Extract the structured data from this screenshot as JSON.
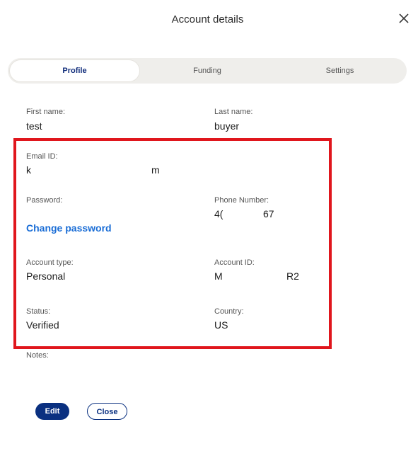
{
  "dialog": {
    "title": "Account details"
  },
  "tabs": [
    {
      "label": "Profile",
      "active": true
    },
    {
      "label": "Funding",
      "active": false
    },
    {
      "label": "Settings",
      "active": false
    }
  ],
  "profile": {
    "first_name": {
      "label": "First name:",
      "value": "test"
    },
    "last_name": {
      "label": "Last name:",
      "value": "buyer"
    },
    "email": {
      "label": "Email ID:",
      "value_start": "k",
      "value_end": "m"
    },
    "password": {
      "label": "Password:",
      "link": "Change password"
    },
    "phone": {
      "label": "Phone Number:",
      "value_start": "4(",
      "value_end": "67"
    },
    "account_type": {
      "label": "Account type:",
      "value": "Personal"
    },
    "account_id": {
      "label": "Account ID:",
      "value_start": "M",
      "value_end": "R2"
    },
    "status": {
      "label": "Status:",
      "value": "Verified"
    },
    "country": {
      "label": "Country:",
      "value": "US"
    },
    "notes": {
      "label": "Notes:"
    }
  },
  "actions": {
    "edit_label": "Edit",
    "close_label": "Close"
  },
  "colors": {
    "highlight_border": "#e0161d",
    "primary": "#0a3080",
    "link": "#1a6dd6",
    "tab_track": "#efeeeb"
  },
  "icons": {
    "close": "close-icon"
  }
}
